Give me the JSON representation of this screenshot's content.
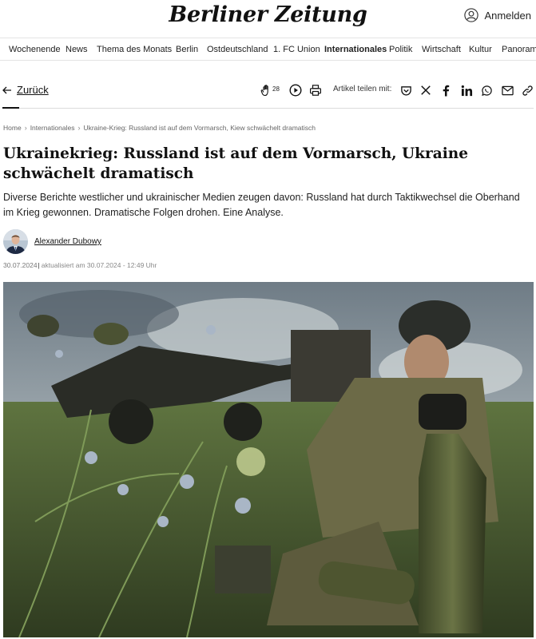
{
  "header": {
    "logo": "Berliner Zeitung",
    "login_label": "Anmelden"
  },
  "nav": {
    "items": [
      "Wochenende",
      "News",
      "Thema des Monats",
      "Berlin",
      "Ostdeutschland",
      "1. FC Union",
      "Internationales",
      "Politik",
      "Wirtschaft",
      "Kultur",
      "Panorama"
    ],
    "active": "Internationales"
  },
  "toolbar": {
    "back_label": "Zurück",
    "clap_count": "28",
    "share_label": "Artikel teilen mit:",
    "share_icons": [
      "pocket-icon",
      "x-icon",
      "facebook-icon",
      "linkedin-icon",
      "whatsapp-icon",
      "mail-icon",
      "link-icon"
    ]
  },
  "breadcrumb": [
    "Home",
    "Internationales",
    "Ukraine-Krieg: Russland ist auf dem Vormarsch, Kiew schwächelt dramatisch"
  ],
  "article": {
    "title": "Ukrainekrieg: Russland ist auf dem Vormarsch, Ukraine schwächelt dramatisch",
    "lead": "Diverse Berichte westlicher und ukrainischer Medien zeugen davon: Russland hat durch Taktikwechsel die Oberhand im Krieg gewonnen. Dramatische Folgen drohen. Eine Analyse.",
    "author": "Alexander Dubowy",
    "date": "30.07.2024",
    "updated": "aktualisiert am 30.07.2024 - 12:49 Uhr"
  },
  "colors": {
    "text": "#1a1a1a",
    "muted": "#777777",
    "divider": "#dcdcdc"
  }
}
